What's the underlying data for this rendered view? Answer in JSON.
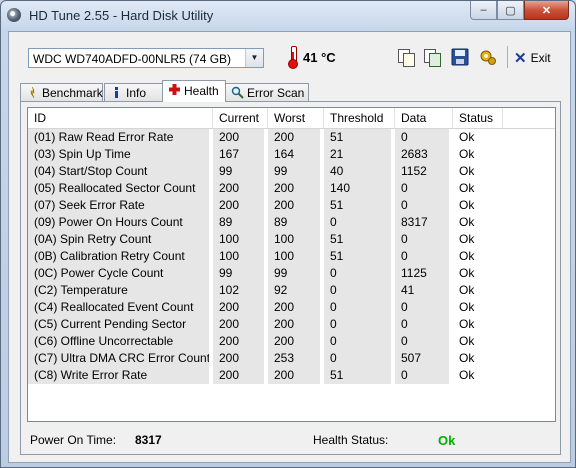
{
  "window": {
    "title": "HD Tune 2.55 - Hard Disk Utility",
    "controls": {
      "minimize": "–",
      "maximize": "▢",
      "close": "✕"
    }
  },
  "toolbar": {
    "drive": "WDC WD740ADFD-00NLR5 (74 GB)",
    "temperature": "41 °C",
    "exit_label": "Exit",
    "icons": [
      "copy-text-icon",
      "copy-screenshot-icon",
      "save-icon",
      "options-icon",
      "thermometer-icon"
    ]
  },
  "tabs": [
    {
      "label": "Benchmark",
      "icon": "benchmark-icon",
      "active": false
    },
    {
      "label": "Info",
      "icon": "info-icon",
      "active": false
    },
    {
      "label": "Health",
      "icon": "health-cross-icon",
      "active": true
    },
    {
      "label": "Error Scan",
      "icon": "magnifier-icon",
      "active": false
    }
  ],
  "table": {
    "columns": [
      "ID",
      "Current",
      "Worst",
      "Threshold",
      "Data",
      "Status"
    ],
    "rows": [
      [
        "(01) Raw Read Error Rate",
        "200",
        "200",
        "51",
        "0",
        "Ok"
      ],
      [
        "(03) Spin Up Time",
        "167",
        "164",
        "21",
        "2683",
        "Ok"
      ],
      [
        "(04) Start/Stop Count",
        "99",
        "99",
        "40",
        "1152",
        "Ok"
      ],
      [
        "(05) Reallocated Sector Count",
        "200",
        "200",
        "140",
        "0",
        "Ok"
      ],
      [
        "(07) Seek Error Rate",
        "200",
        "200",
        "51",
        "0",
        "Ok"
      ],
      [
        "(09) Power On Hours Count",
        "89",
        "89",
        "0",
        "8317",
        "Ok"
      ],
      [
        "(0A) Spin Retry Count",
        "100",
        "100",
        "51",
        "0",
        "Ok"
      ],
      [
        "(0B) Calibration Retry Count",
        "100",
        "100",
        "51",
        "0",
        "Ok"
      ],
      [
        "(0C) Power Cycle Count",
        "99",
        "99",
        "0",
        "1125",
        "Ok"
      ],
      [
        "(C2) Temperature",
        "102",
        "92",
        "0",
        "41",
        "Ok"
      ],
      [
        "(C4) Reallocated Event Count",
        "200",
        "200",
        "0",
        "0",
        "Ok"
      ],
      [
        "(C5) Current Pending Sector",
        "200",
        "200",
        "0",
        "0",
        "Ok"
      ],
      [
        "(C6) Offline Uncorrectable",
        "200",
        "200",
        "0",
        "0",
        "Ok"
      ],
      [
        "(C7) Ultra DMA CRC Error Count",
        "200",
        "253",
        "0",
        "507",
        "Ok"
      ],
      [
        "(C8) Write Error Rate",
        "200",
        "200",
        "51",
        "0",
        "Ok"
      ]
    ]
  },
  "status": {
    "power_on_label": "Power On Time:",
    "power_on_value": "8317",
    "health_label": "Health Status:",
    "health_value": "Ok",
    "health_color": "#00b000"
  }
}
